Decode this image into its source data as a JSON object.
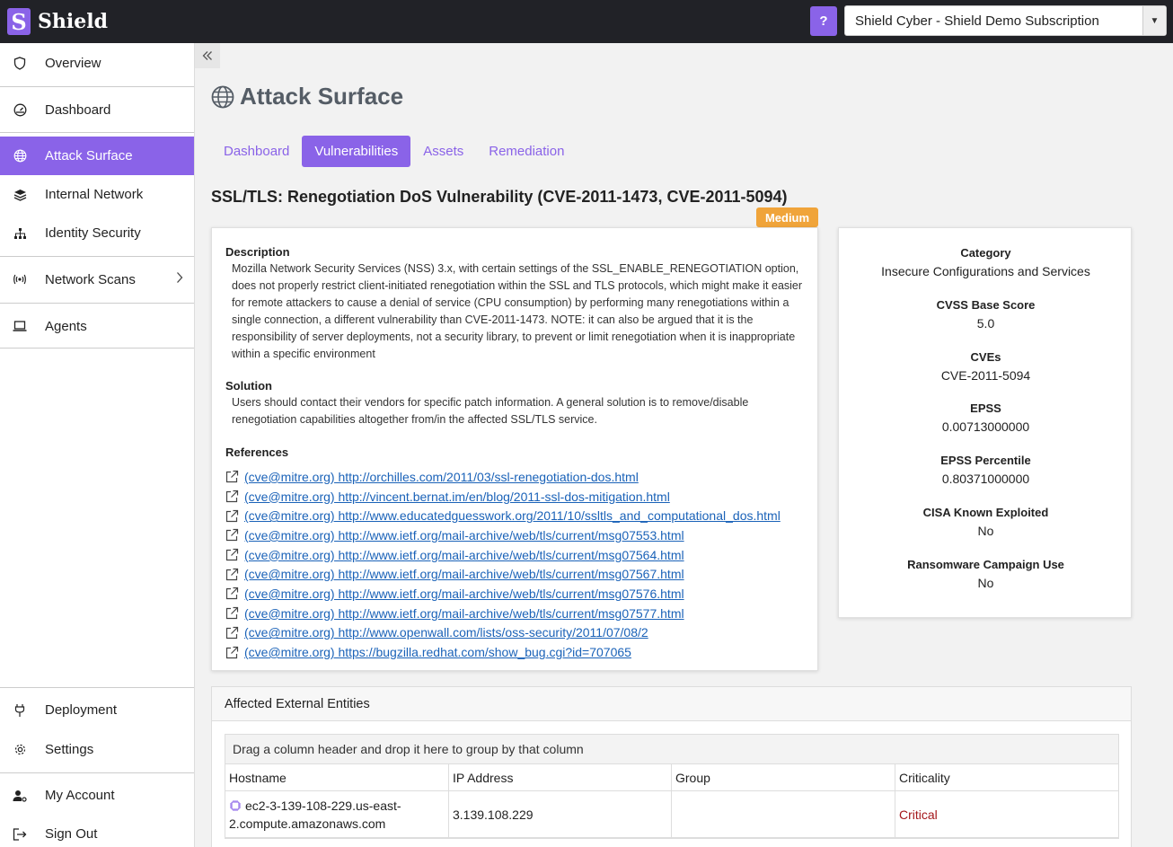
{
  "app": {
    "name": "Shield",
    "logo_letter": "S",
    "help_label": "?",
    "subscription": "Shield Cyber - Shield Demo Subscription"
  },
  "sidebar": {
    "items": [
      {
        "label": "Overview",
        "icon": "shield-icon"
      },
      {
        "label": "Dashboard",
        "icon": "gauge-icon"
      },
      {
        "label": "Attack Surface",
        "icon": "globe-icon"
      },
      {
        "label": "Internal Network",
        "icon": "layers-icon"
      },
      {
        "label": "Identity Security",
        "icon": "sitemap-icon"
      },
      {
        "label": "Network Scans",
        "icon": "broadcast-icon"
      },
      {
        "label": "Agents",
        "icon": "laptop-icon"
      },
      {
        "label": "Deployment",
        "icon": "plug-icon"
      },
      {
        "label": "Settings",
        "icon": "gear-icon"
      },
      {
        "label": "My Account",
        "icon": "user-cog-icon"
      },
      {
        "label": "Sign Out",
        "icon": "sign-out-icon"
      }
    ]
  },
  "page": {
    "title": "Attack Surface"
  },
  "tabs": [
    "Dashboard",
    "Vulnerabilities",
    "Assets",
    "Remediation"
  ],
  "vulnerability": {
    "title": "SSL/TLS: Renegotiation DoS Vulnerability (CVE-2011-1473, CVE-2011-5094)",
    "severity": "Medium",
    "description_label": "Description",
    "description": "Mozilla Network Security Services (NSS) 3.x, with certain settings of the SSL_ENABLE_RENEGOTIATION option, does not properly restrict client-initiated renegotiation within the SSL and TLS protocols, which might make it easier for remote attackers to cause a denial of service (CPU consumption) by performing many renegotiations within a single connection, a different vulnerability than CVE-2011-1473. NOTE: it can also be argued that it is the responsibility of server deployments, not a security library, to prevent or limit renegotiation when it is inappropriate within a specific environment",
    "solution_label": "Solution",
    "solution": "Users should contact their vendors for specific patch information. A general solution is to remove/disable renegotiation capabilities altogether from/in the affected SSL/TLS service.",
    "references_label": "References",
    "references": [
      "(cve@mitre.org) http://orchilles.com/2011/03/ssl-renegotiation-dos.html",
      "(cve@mitre.org) http://vincent.bernat.im/en/blog/2011-ssl-dos-mitigation.html",
      "(cve@mitre.org) http://www.educatedguesswork.org/2011/10/ssltls_and_computational_dos.html",
      "(cve@mitre.org) http://www.ietf.org/mail-archive/web/tls/current/msg07553.html",
      "(cve@mitre.org) http://www.ietf.org/mail-archive/web/tls/current/msg07564.html",
      "(cve@mitre.org) http://www.ietf.org/mail-archive/web/tls/current/msg07567.html",
      "(cve@mitre.org) http://www.ietf.org/mail-archive/web/tls/current/msg07576.html",
      "(cve@mitre.org) http://www.ietf.org/mail-archive/web/tls/current/msg07577.html",
      "(cve@mitre.org) http://www.openwall.com/lists/oss-security/2011/07/08/2",
      "(cve@mitre.org) https://bugzilla.redhat.com/show_bug.cgi?id=707065"
    ]
  },
  "meta": [
    {
      "label": "Category",
      "value": "Insecure Configurations and Services"
    },
    {
      "label": "CVSS Base Score",
      "value": "5.0"
    },
    {
      "label": "CVEs",
      "value": "CVE-2011-5094"
    },
    {
      "label": "EPSS",
      "value": "0.00713000000"
    },
    {
      "label": "EPSS Percentile",
      "value": "0.80371000000"
    },
    {
      "label": "CISA Known Exploited",
      "value": "No"
    },
    {
      "label": "Ransomware Campaign Use",
      "value": "No"
    }
  ],
  "entities": {
    "title": "Affected External Entities",
    "group_hint": "Drag a column header and drop it here to group by that column",
    "columns": [
      "Hostname",
      "IP Address",
      "Group",
      "Criticality"
    ],
    "rows": [
      {
        "hostname_1": "ec2-3-139-108-229.us-east-",
        "hostname_2": "2.compute.amazonaws.com",
        "ip": "3.139.108.229",
        "group": "",
        "criticality": "Critical"
      }
    ]
  },
  "colors": {
    "accent": "#8a63e8",
    "severity_medium": "#f0a43a",
    "critical": "#a4161a",
    "topbar": "#212227"
  }
}
